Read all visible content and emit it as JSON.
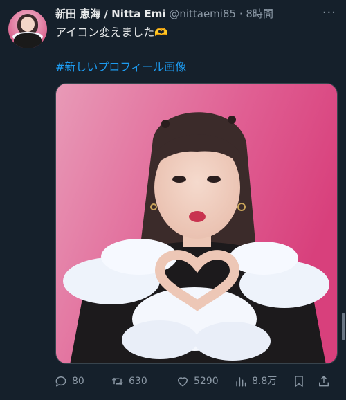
{
  "tweet": {
    "author_name": "新田 恵海 / Nitta Emi",
    "handle": "@nittaemi85",
    "separator": "·",
    "time": "8時間",
    "more_label": "···",
    "text": "アイコン変えました🫶",
    "hashtag": "#新しいプロフィール画像"
  },
  "actions": {
    "reply_count": "80",
    "retweet_count": "630",
    "like_count": "5290",
    "views_count": "8.8万"
  },
  "icons": {
    "reply": "reply-icon",
    "retweet": "retweet-icon",
    "like": "heart-icon",
    "views": "views-icon",
    "bookmark": "bookmark-icon",
    "share": "share-icon"
  },
  "colors": {
    "background": "#15202b",
    "text": "#e7e9ea",
    "secondary": "#8b98a5",
    "link": "#1d9bf0"
  }
}
